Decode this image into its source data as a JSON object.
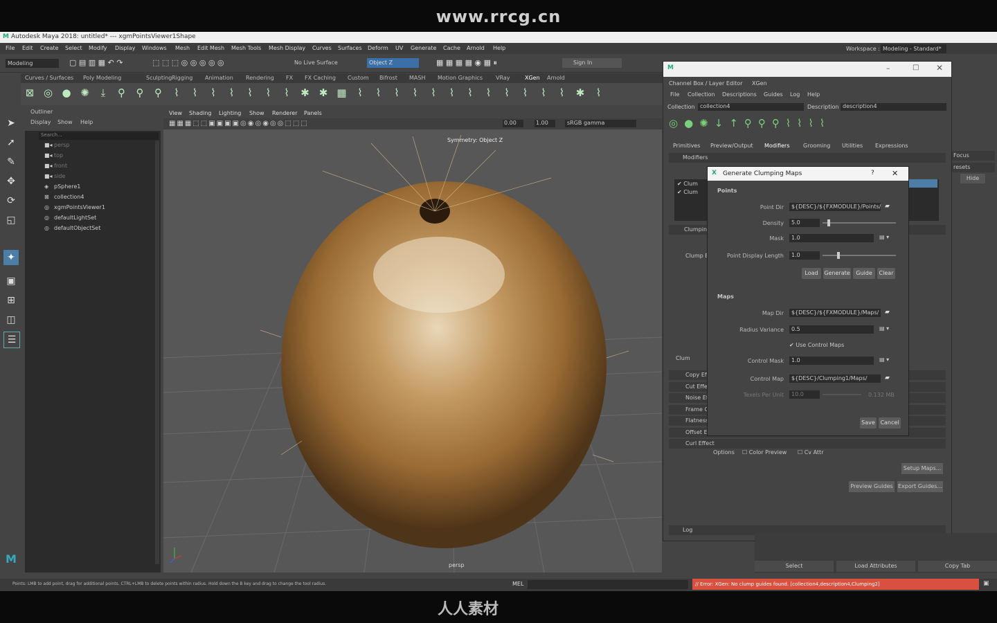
{
  "watermark": {
    "site": "www.rrcg.cn",
    "brand": "人人素材"
  },
  "window": {
    "title": "Autodesk Maya 2018: untitled*   ---   xgmPointsViewer1Shape",
    "workspace_label": "Workspace :",
    "workspace_value": "Modeling - Standard*"
  },
  "menubar": [
    "File",
    "Edit",
    "Create",
    "Select",
    "Modify",
    "Display",
    "Windows",
    "Mesh",
    "Edit Mesh",
    "Mesh Tools",
    "Mesh Display",
    "Curves",
    "Surfaces",
    "Deform",
    "UV",
    "Generate",
    "Cache",
    "Arnold",
    "Help"
  ],
  "toolbar": {
    "mode": "Modeling",
    "live_surface": "No Live Surface",
    "symmetry": "Object Z",
    "sign_in": "Sign In"
  },
  "shelf_tabs": [
    "Curves / Surfaces",
    "Poly Modeling",
    "Sculpting",
    "Rigging",
    "Animation",
    "Rendering",
    "FX",
    "FX Caching",
    "Custom",
    "Bifrost",
    "MASH",
    "Motion Graphics",
    "VRay",
    "XGen",
    "Arnold"
  ],
  "outliner": {
    "title": "Outliner",
    "menu": [
      "Display",
      "Show",
      "Help"
    ],
    "search_placeholder": "Search...",
    "items": [
      "persp",
      "top",
      "front",
      "side",
      "pSphere1",
      "collection4",
      "xgmPointsViewer1",
      "defaultLightSet",
      "defaultObjectSet"
    ]
  },
  "viewport": {
    "menu": [
      "View",
      "Shading",
      "Lighting",
      "Show",
      "Renderer",
      "Panels"
    ],
    "exposure": "0.00",
    "gamma": "1.00",
    "colorspace": "sRGB gamma",
    "symmetry_label": "Symmetry: Object Z",
    "camera": "persp"
  },
  "xgen": {
    "tabs": [
      "Channel Box / Layer Editor",
      "XGen"
    ],
    "menu": [
      "File",
      "Collection",
      "Descriptions",
      "Guides",
      "Log",
      "Help"
    ],
    "collection_label": "Collection",
    "collection_value": "collection4",
    "description_label": "Description",
    "description_value": "description4",
    "subtabs": [
      "Primitives",
      "Preview/Output",
      "Modifiers",
      "Grooming",
      "Utilities",
      "Expressions"
    ],
    "section_modifiers": "Modifiers",
    "mod_items": [
      "Clum",
      "Clum"
    ],
    "section_clumping": "Clumpin",
    "section_clump": "Clump E",
    "clum_label": "Clum",
    "effects": [
      "Copy Eff",
      "Cut Effe",
      "Noise Ef",
      "Frame O",
      "Flatness",
      "Offset Ef",
      "Curl Effect"
    ],
    "options_label": "Options",
    "color_preview": "Color Preview",
    "cv_attr": "Cv Attr",
    "setup_maps": "Setup Maps...",
    "preview_guides": "Preview Guides",
    "export_guides": "Export Guides...",
    "log": "Log"
  },
  "dialog": {
    "title": "Generate Clumping Maps",
    "points_header": "Points",
    "point_dir_label": "Point Dir",
    "point_dir_value": "${DESC}/${FXMODULE}/Points/",
    "density_label": "Density",
    "density_value": "5.0",
    "mask_label": "Mask",
    "mask_value": "1.0",
    "pdl_label": "Point Display Length",
    "pdl_value": "1.0",
    "load": "Load",
    "generate": "Generate",
    "guide": "Guide",
    "clear": "Clear",
    "maps_header": "Maps",
    "map_dir_label": "Map Dir",
    "map_dir_value": "${DESC}/${FXMODULE}/Maps/",
    "radius_label": "Radius Variance",
    "radius_value": "0.5",
    "use_control": "Use Control Maps",
    "control_mask_label": "Control Mask",
    "control_mask_value": "1.0",
    "control_map_label": "Control Map",
    "control_map_value": "${DESC}/Clumping1/Maps/",
    "texels_label": "Texels Per Unit",
    "texels_value": "10.0",
    "size": "0.132 MB",
    "save": "Save",
    "cancel": "Cancel"
  },
  "right_panel": {
    "focus": "Focus",
    "presets": "resets",
    "hide": "Hide"
  },
  "channel_bottom": [
    "Select",
    "Load Attributes",
    "Copy Tab"
  ],
  "status_line": "Points: LMB to add point, drag for additional points. CTRL+LMB to delete points within radius. Hold down the B key and drag to change the tool radius.",
  "mel_label": "MEL",
  "error": "// Error: XGen:  No clump guides found. [collection4,description4,Clumping2]"
}
